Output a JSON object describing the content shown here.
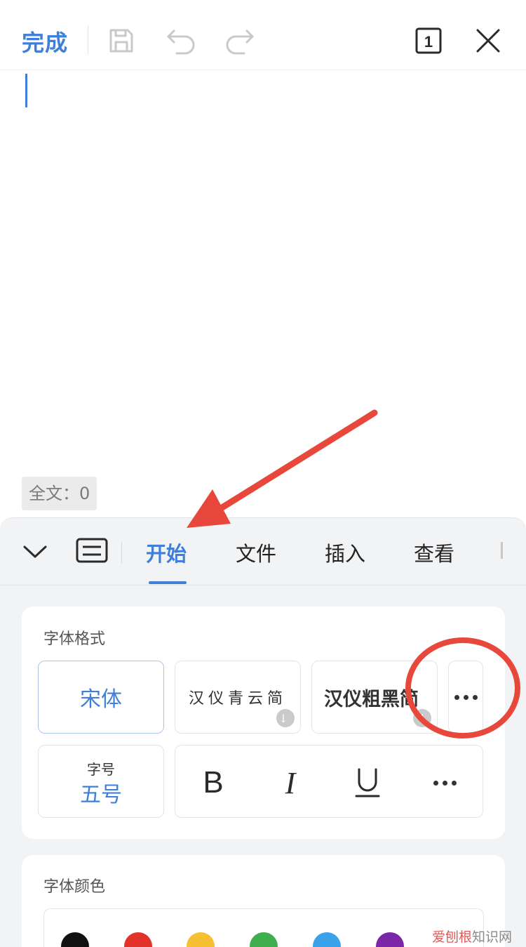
{
  "toolbar": {
    "done_label": "完成",
    "page_indicator": "1",
    "icons": [
      "save-icon",
      "undo-icon",
      "redo-icon",
      "page-view-icon",
      "close-icon"
    ],
    "accent_color": "#3f7fd9"
  },
  "status": {
    "word_count": "全文：0"
  },
  "ribbon": {
    "tabs": [
      {
        "label": "开始",
        "active": true
      },
      {
        "label": "文件",
        "active": false
      },
      {
        "label": "插入",
        "active": false
      },
      {
        "label": "查看",
        "active": false
      }
    ]
  },
  "font_format": {
    "title": "字体格式",
    "fonts": [
      {
        "label": "宋体",
        "selected": true
      },
      {
        "label": "汉仪青云简",
        "downloadable": true
      },
      {
        "label": "汉仪粗黑简",
        "downloadable": true
      }
    ],
    "size_label": "字号",
    "size_value": "五号",
    "style_buttons": [
      "bold-icon",
      "italic-icon",
      "underline-icon",
      "more-icon"
    ],
    "bold_glyph": "B",
    "italic_glyph": "I"
  },
  "font_color": {
    "title": "字体颜色",
    "swatches": [
      "#111111",
      "#e2332b",
      "#f5c032",
      "#3fae4e",
      "#3aa2ea",
      "#7a27a8"
    ]
  },
  "annotation": {
    "arrow_color": "#e8483c",
    "circle_color": "#e8483c"
  },
  "watermark": {
    "brand": "爱刨根",
    "site": "知识网"
  }
}
